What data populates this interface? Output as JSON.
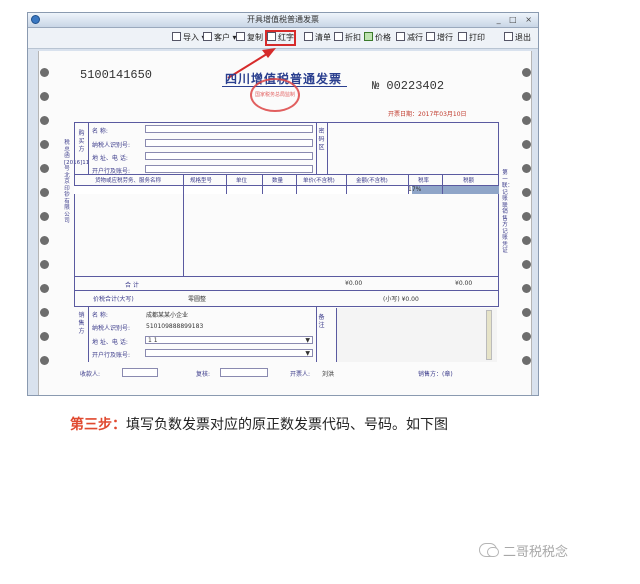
{
  "window": {
    "title": "开具增值税普通发票",
    "controls": "_ □ ×"
  },
  "toolbar": {
    "items": [
      {
        "label": "导入 ▾"
      },
      {
        "label": "客户 ▾"
      },
      {
        "label": "复制"
      },
      {
        "label": "红字"
      },
      {
        "label": "清单"
      },
      {
        "label": "折扣"
      },
      {
        "label": "价格"
      },
      {
        "label": "减行"
      },
      {
        "label": "增行"
      },
      {
        "label": "打印"
      },
      {
        "label": "退出"
      }
    ]
  },
  "invoice": {
    "code": "5100141650",
    "title": "四川增值税普通发票",
    "number_prefix": "№",
    "number": "00223402",
    "date": "开票日期：2017年03月10日",
    "stamp_text": "国家税务总局监制",
    "buyer": {
      "side_label": "购买方",
      "name_label": "名 称:",
      "tax_id_label": "纳税人识别号:",
      "address_label": "地 址、电 话:",
      "bank_label": "开户行及账号:",
      "pwd_label": "密码区"
    },
    "columns": [
      "货物或应税劳务、服务名称",
      "规格型号",
      "单位",
      "数量",
      "单价(不含税)",
      "金额(不含税)",
      "税率",
      "税额"
    ],
    "row1_rate": "17%",
    "total_label": "合 计",
    "total_amount": "¥0.00",
    "total_tax": "¥0.00",
    "grand_total_label": "价税合计(大写)",
    "grand_total_caps": "零圆整",
    "grand_total_small": "(小写) ¥0.00",
    "seller": {
      "side_label": "销售方",
      "name_label": "名 称:",
      "name_value": "成都某某小企业",
      "tax_id_label": "纳税人识别号:",
      "tax_id_value": "510109888899183",
      "address_label": "地 址、电 话:",
      "address_value": "1 1",
      "bank_label": "开户行及账号:",
      "note_label": "备注"
    },
    "footer": {
      "payee_label": "收款人:",
      "checker_label": "复核:",
      "issuer_label": "开票人:",
      "issuer_value": "刘洪",
      "seller_seal_label": "销售方：(章)"
    },
    "left_side_text": "税总函[2016]11号北京印钞有限公司",
    "right_side_text": "第一联：记账联 销售方记账凭证"
  },
  "instruction": {
    "step": "第三步：",
    "text": "填写负数发票对应的原正数发票代码、号码。如下图"
  },
  "brand": {
    "text": "二哥税税念"
  },
  "colors": {
    "highlight": "#d62b2b",
    "selected_row": "#8fa5c8",
    "step": "#e0492f",
    "invoice_blue": "#2a3f8f"
  }
}
